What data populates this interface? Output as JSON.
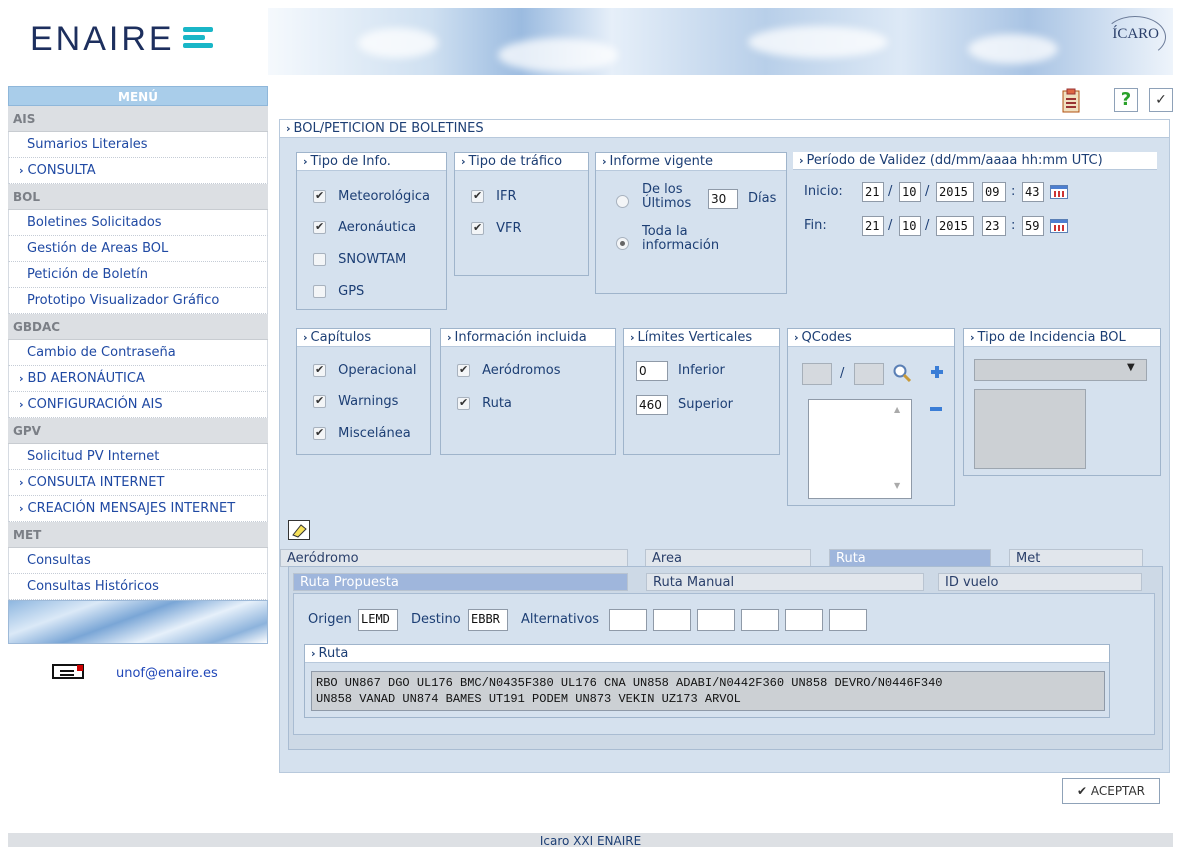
{
  "header": {
    "logo_text": "ENAIRE",
    "brand_right": "ÍCARO"
  },
  "menu": {
    "title": "MENÚ",
    "sections": [
      {
        "label": "AIS",
        "items": [
          {
            "label": "Sumarios Literales",
            "sub": false
          },
          {
            "label": "CONSULTA",
            "sub": true
          }
        ]
      },
      {
        "label": "BOL",
        "items": [
          {
            "label": "Boletines Solicitados",
            "sub": false
          },
          {
            "label": "Gestión de Areas BOL",
            "sub": false
          },
          {
            "label": "Petición de Boletín",
            "sub": false
          },
          {
            "label": "Prototipo Visualizador Gráfico",
            "sub": false
          }
        ]
      },
      {
        "label": "GBDAC",
        "items": [
          {
            "label": "Cambio de Contraseña",
            "sub": false
          },
          {
            "label": "BD AERONÁUTICA",
            "sub": true
          },
          {
            "label": "CONFIGURACIÓN AIS",
            "sub": true
          }
        ]
      },
      {
        "label": "GPV",
        "items": [
          {
            "label": "Solicitud PV Internet",
            "sub": false
          },
          {
            "label": "CONSULTA INTERNET",
            "sub": true
          },
          {
            "label": "CREACIÓN MENSAJES INTERNET",
            "sub": true
          }
        ]
      },
      {
        "label": "MET",
        "items": [
          {
            "label": "Consultas",
            "sub": false
          },
          {
            "label": "Consultas Históricos",
            "sub": false
          }
        ]
      }
    ],
    "email": "unof@enaire.es"
  },
  "toolbar": {
    "help_label": "?",
    "check_label": "✓"
  },
  "page": {
    "title": "BOL/PETICION DE BOLETINES"
  },
  "tipo_info": {
    "title": "Tipo de Info.",
    "options": [
      {
        "label": "Meteorológica",
        "checked": true
      },
      {
        "label": "Aeronáutica",
        "checked": true
      },
      {
        "label": "SNOWTAM",
        "checked": false
      },
      {
        "label": "GPS",
        "checked": false
      }
    ]
  },
  "tipo_trafico": {
    "title": "Tipo de tráfico",
    "options": [
      {
        "label": "IFR",
        "checked": true
      },
      {
        "label": "VFR",
        "checked": true
      }
    ]
  },
  "informe": {
    "title": "Informe vigente",
    "opt1_a": "De los",
    "opt1_b": "Últimos",
    "dias_value": "30",
    "dias_label": "Días",
    "opt2_a": "Toda la",
    "opt2_b": "información",
    "selected": 2
  },
  "periodo": {
    "title": "Período de Validez (dd/mm/aaaa hh:mm UTC)",
    "inicio_label": "Inicio:",
    "fin_label": "Fin:",
    "inicio": {
      "d": "21",
      "m": "10",
      "y": "2015",
      "h": "09",
      "min": "43"
    },
    "fin": {
      "d": "21",
      "m": "10",
      "y": "2015",
      "h": "23",
      "min": "59"
    },
    "sep_slash": "/",
    "sep_colon": ":"
  },
  "capitulos": {
    "title": "Capítulos",
    "options": [
      {
        "label": "Operacional",
        "checked": true
      },
      {
        "label": "Warnings",
        "checked": true
      },
      {
        "label": "Miscelánea",
        "checked": true
      }
    ]
  },
  "info_incl": {
    "title": "Información incluida",
    "options": [
      {
        "label": "Aeródromos",
        "checked": true
      },
      {
        "label": "Ruta",
        "checked": true
      }
    ]
  },
  "limites": {
    "title": "Límites Verticales",
    "inferior_value": "0",
    "inferior_label": "Inferior",
    "superior_value": "460",
    "superior_label": "Superior"
  },
  "qcodes": {
    "title": "QCodes",
    "sep": "/"
  },
  "incidencia": {
    "title": "Tipo de Incidencia BOL"
  },
  "tabs1": [
    {
      "label": "Aeródromo",
      "active": false
    },
    {
      "label": "Area",
      "active": false
    },
    {
      "label": "Ruta",
      "active": true
    },
    {
      "label": "Met",
      "active": false
    }
  ],
  "tabs2": [
    {
      "label": "Ruta Propuesta",
      "active": true
    },
    {
      "label": "Ruta Manual",
      "active": false
    },
    {
      "label": "ID vuelo",
      "active": false
    }
  ],
  "ruta_form": {
    "origen_label": "Origen",
    "origen_value": "LEMD",
    "destino_label": "Destino",
    "destino_value": "EBBR",
    "alternativos_label": "Alternativos"
  },
  "ruta": {
    "title": "Ruta",
    "line1": "RBO UN867 DGO UL176 BMC/N0435F380 UL176 CNA UN858 ADABI/N0442F360 UN858 DEVRO/N0446F340",
    "line2": "UN858 VANAD UN874 BAMES UT191 PODEM UN873 VEKIN UZ173 ARVOL"
  },
  "aceptar": "✔ ACEPTAR",
  "footer": "Icaro XXI ENAIRE"
}
